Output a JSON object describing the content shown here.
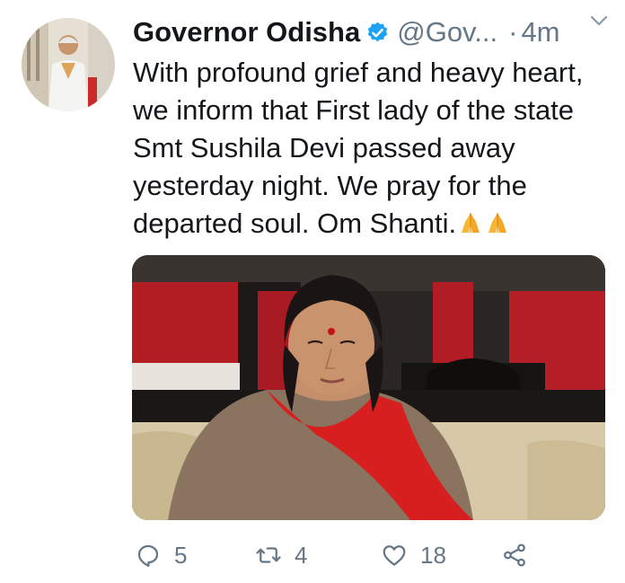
{
  "tweet": {
    "author_name": "Governor Odisha",
    "handle": "@Gov...",
    "separator": "·",
    "time": "4m",
    "text": "With profound grief and heavy heart, we inform that First lady of the state  Smt Sushila Devi passed away yesterday night. We pray for the departed soul. Om Shanti.",
    "emoji": [
      "folded-hands",
      "folded-hands"
    ],
    "verified": true
  },
  "actions": {
    "reply_count": "5",
    "retweet_count": "4",
    "like_count": "18"
  },
  "icons": {
    "verified": "verified-badge-icon",
    "caret": "chevron-down-icon",
    "reply": "reply-icon",
    "retweet": "retweet-icon",
    "like": "heart-icon",
    "share": "share-icon"
  },
  "colors": {
    "text": "#14171a",
    "secondary": "#657786",
    "verified": "#1da1f2",
    "emoji": "#f7b733"
  }
}
